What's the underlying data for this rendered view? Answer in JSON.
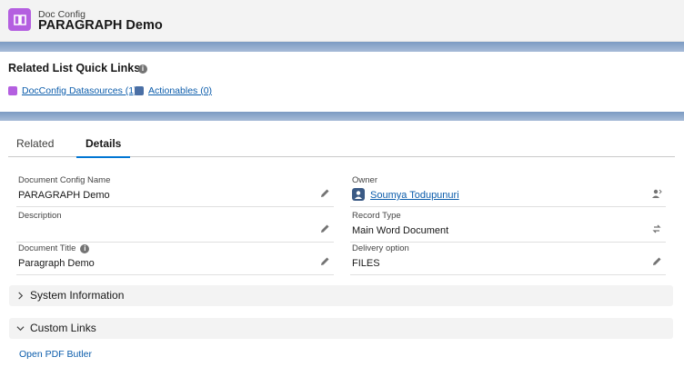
{
  "header": {
    "subtitle": "Doc Config",
    "title": "PARAGRAPH Demo"
  },
  "quick_links": {
    "title": "Related List Quick Links",
    "links": [
      {
        "label": "DocConfig Datasources (1)",
        "color": "#b45fe0"
      },
      {
        "label": "Actionables (0)",
        "color": "#4a6fa5"
      }
    ]
  },
  "tabs": [
    {
      "label": "Related",
      "active": false
    },
    {
      "label": "Details",
      "active": true
    }
  ],
  "fields": {
    "doc_config_name": {
      "label": "Document Config Name",
      "value": "PARAGRAPH Demo"
    },
    "owner": {
      "label": "Owner",
      "value": "Soumya Todupunuri"
    },
    "description": {
      "label": "Description",
      "value": ""
    },
    "record_type": {
      "label": "Record Type",
      "value": "Main Word Document"
    },
    "document_title": {
      "label": "Document Title",
      "value": "Paragraph Demo"
    },
    "delivery_option": {
      "label": "Delivery option",
      "value": "FILES"
    }
  },
  "sections": {
    "system_information": "System Information",
    "custom_links": "Custom Links"
  },
  "custom_links": {
    "open_pdf_butler": "Open PDF Butler"
  },
  "colors": {
    "accent": "#0176d3",
    "link": "#0b5cab",
    "app_icon": "#b45fe0"
  }
}
